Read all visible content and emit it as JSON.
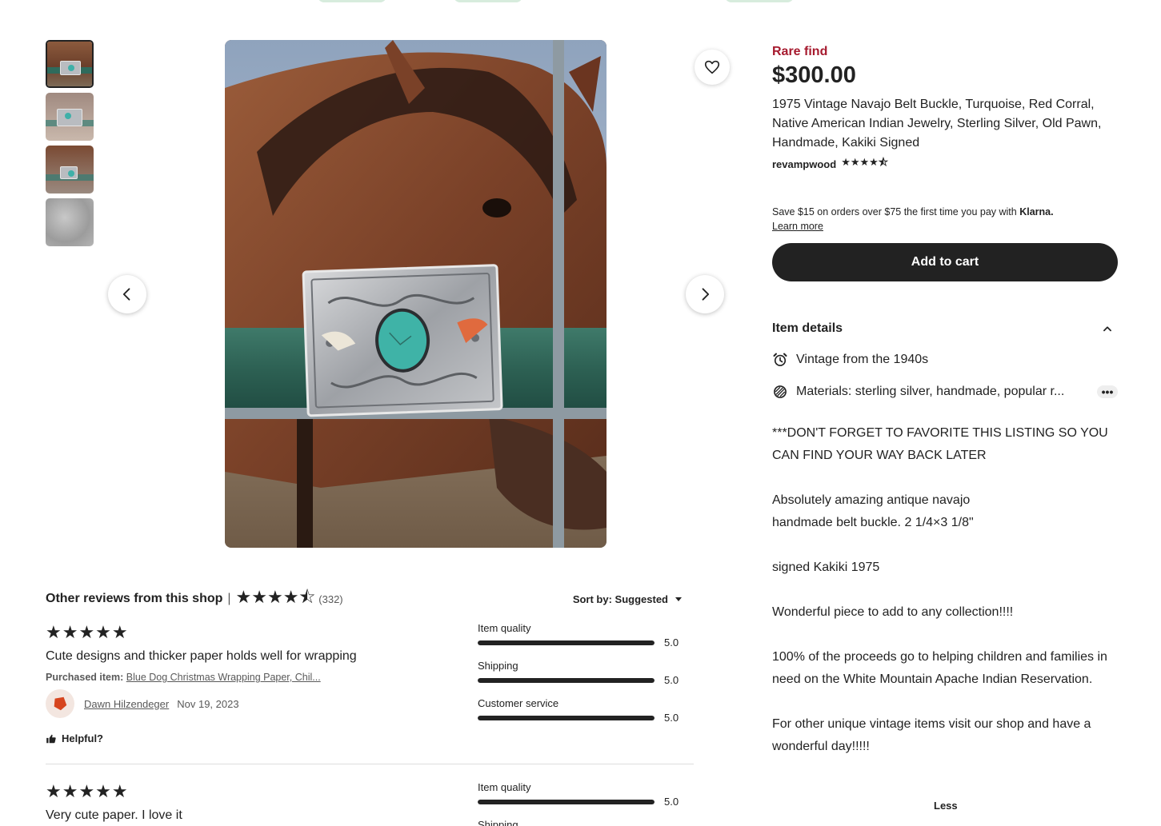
{
  "gallery": {
    "thumb_count": 4,
    "active_index": 0
  },
  "listing": {
    "badge": "Rare find",
    "price": "$300.00",
    "title": "1975 Vintage Navajo Belt Buckle, Turquoise, Red Corral, Native American Indian Jewelry, Sterling Silver, Old Pawn, Handmade, Kakiki Signed",
    "shop_name": "revampwood",
    "shop_stars": "★★★★⯪",
    "shop_rating": 4.5,
    "klarna_text": "Save $15 on orders over $75 the first time you pay with ",
    "klarna_brand": "Klarna.",
    "learn_more": "Learn more",
    "add_to_cart": "Add to cart"
  },
  "details": {
    "heading": "Item details",
    "vintage": "Vintage from the 1940s",
    "materials": "Materials: sterling silver, handmade, popular r...",
    "more": "•••",
    "description": [
      "***DON'T FORGET TO FAVORITE THIS LISTING SO YOU CAN FIND YOUR WAY BACK LATER",
      "Absolutely amazing antique navajo\nhandmade belt buckle. 2 1/4×3 1/8\"",
      "signed Kakiki 1975",
      "Wonderful piece to add to any collection!!!!",
      "100% of the proceeds go to helping children and families in need on the White Mountain Apache Indian Reservation.",
      "For other unique vintage items visit our shop and have a wonderful day!!!!!"
    ],
    "less": "Less"
  },
  "reviews": {
    "heading": "Other reviews from this shop",
    "separator": "|",
    "stars": "★★★★⯪",
    "count": "(332)",
    "sort_label": "Sort by: Suggested",
    "items": [
      {
        "stars": "★★★★★",
        "text": "Cute designs and thicker paper holds well for wrapping",
        "purchased_label": "Purchased item:",
        "purchased_item": "Blue Dog Christmas Wrapping Paper, Chil...",
        "author": "Dawn Hilzendeger",
        "date": "Nov 19, 2023",
        "helpful": "Helpful?",
        "ratings": [
          {
            "label": "Item quality",
            "value": "5.0",
            "fraction": 1.0
          },
          {
            "label": "Shipping",
            "value": "5.0",
            "fraction": 1.0
          },
          {
            "label": "Customer service",
            "value": "5.0",
            "fraction": 1.0
          }
        ]
      },
      {
        "stars": "★★★★★",
        "text": "Very cute paper. I love it",
        "ratings": [
          {
            "label": "Item quality",
            "value": "5.0",
            "fraction": 1.0
          },
          {
            "label": "Shipping",
            "value": "",
            "fraction": 1.0
          }
        ]
      }
    ]
  },
  "colors": {
    "accent_red": "#a61a2e",
    "dark": "#222222",
    "top_pill": "#d7ecdd"
  },
  "icons": {
    "favorite": "heart-icon",
    "prev": "chevron-left-icon",
    "next": "chevron-right-icon",
    "collapse": "chevron-up-icon",
    "vintage": "alarm-clock-icon",
    "materials": "materials-icon",
    "sort": "caret-down-icon",
    "helpful": "thumbs-up-icon"
  }
}
